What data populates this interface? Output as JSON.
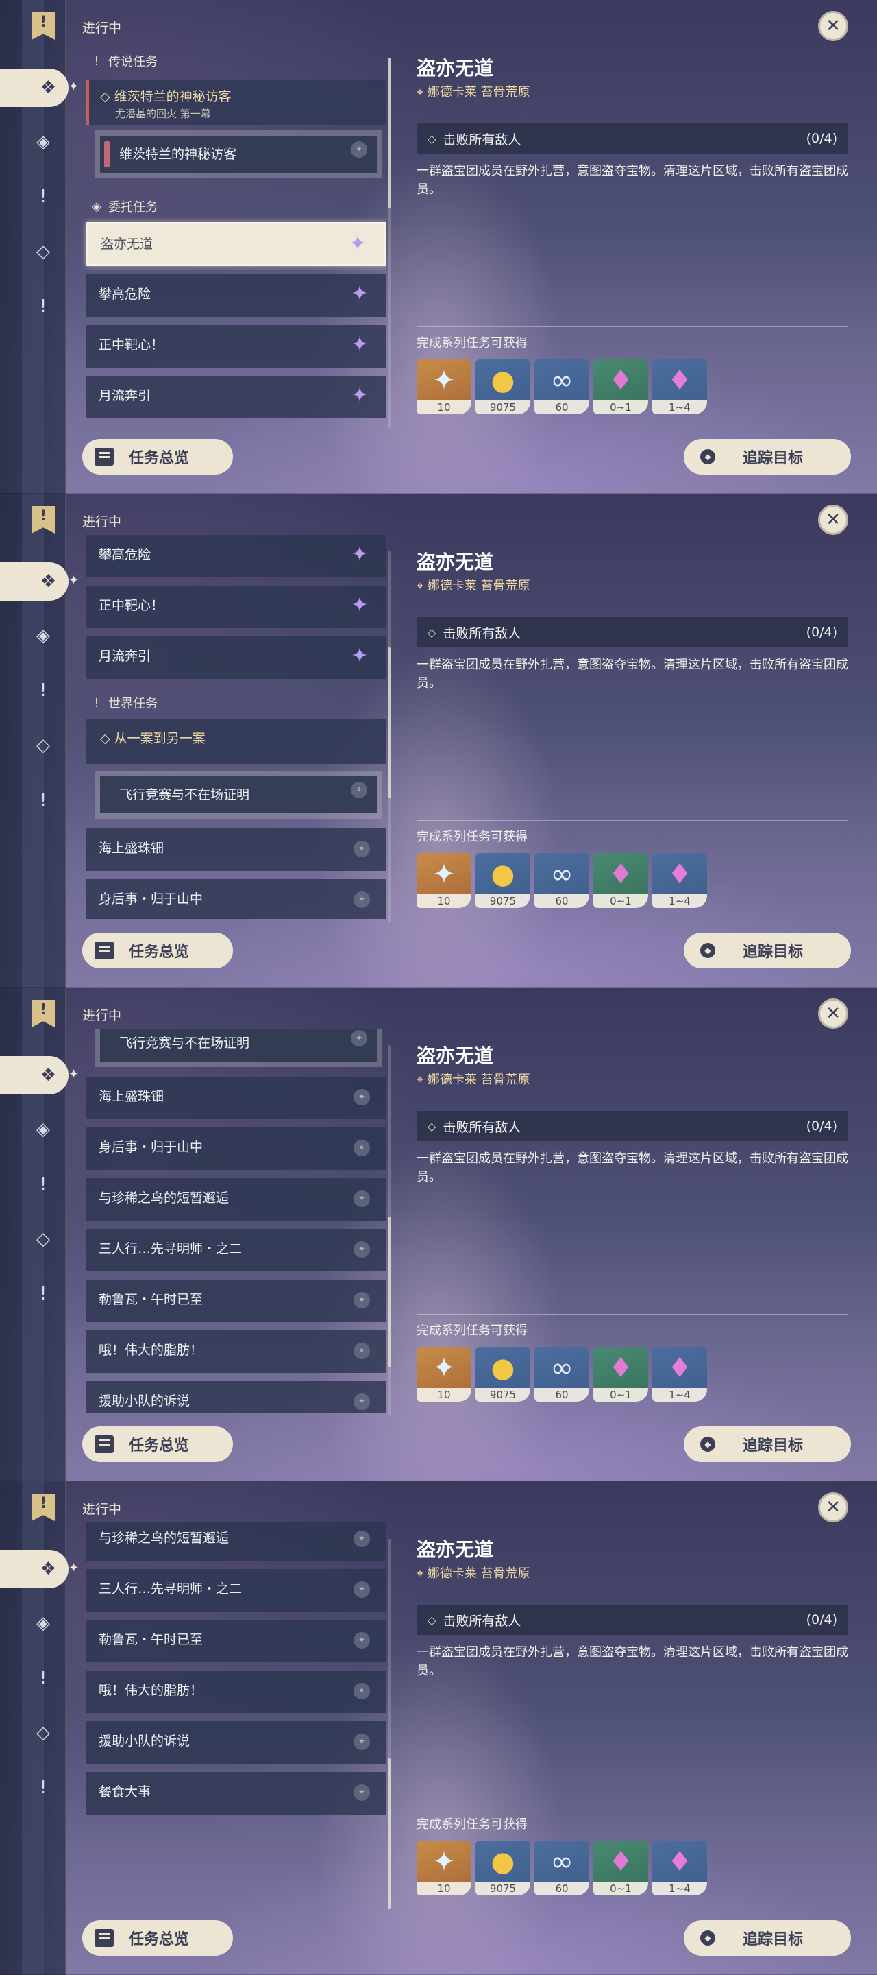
{
  "status_label": "进行中",
  "close_icon": "close-icon",
  "detail": {
    "title": "盗亦无道",
    "location_icon": "location-pin-icon",
    "location": "娜德卡莱 苔骨荒原",
    "objective": "击败所有敌人",
    "objective_count": "(0/4)",
    "description": "一群盗宝团成员在野外扎营，意图盗夺宝物。清理这片区域，击败所有盗宝团成员。",
    "rewards_label": "完成系列任务可获得",
    "rewards": [
      {
        "icon": "primogem-icon",
        "value": "10"
      },
      {
        "icon": "mora-icon",
        "value": "9075"
      },
      {
        "icon": "companionship-exp-icon",
        "value": "60"
      },
      {
        "icon": "crystal-icon",
        "value": "0~1"
      },
      {
        "icon": "crystal-cluster-icon",
        "value": "1~4"
      }
    ]
  },
  "buttons": {
    "overview": "任务总览",
    "track": "追踪目标"
  },
  "rail": {
    "flag_icon": "quest-flag-icon",
    "icons": [
      "all-quests-icon",
      "archon-quest-icon",
      "story-quest-icon",
      "commission-icon",
      "world-quest-icon"
    ]
  },
  "categories": {
    "legend": "传说任务",
    "commission": "委托任务",
    "world": "世界任务"
  },
  "quests": {
    "legend_parent_title": "维茨特兰的神秘访客",
    "legend_parent_sub": "尤潘基的回火 第一幕",
    "legend_child": "维茨特兰的神秘访客",
    "c1": "盗亦无道",
    "c2": "攀高危险",
    "c3": "正中靶心！",
    "c4": "月流奔引",
    "world_parent": "从一案到另一案",
    "world_child": "飞行竞赛与不在场证明",
    "w1": "海上盛珠钿",
    "w2": "身后事・归于山中",
    "w3": "与珍稀之鸟的短暂邂逅",
    "w4": "三人行…先寻明师・之二",
    "w5": "勒鲁瓦・午时已至",
    "w6": "哦！伟大的脂肪！",
    "w7": "援助小队的诉说",
    "w8": "餐食大事"
  }
}
